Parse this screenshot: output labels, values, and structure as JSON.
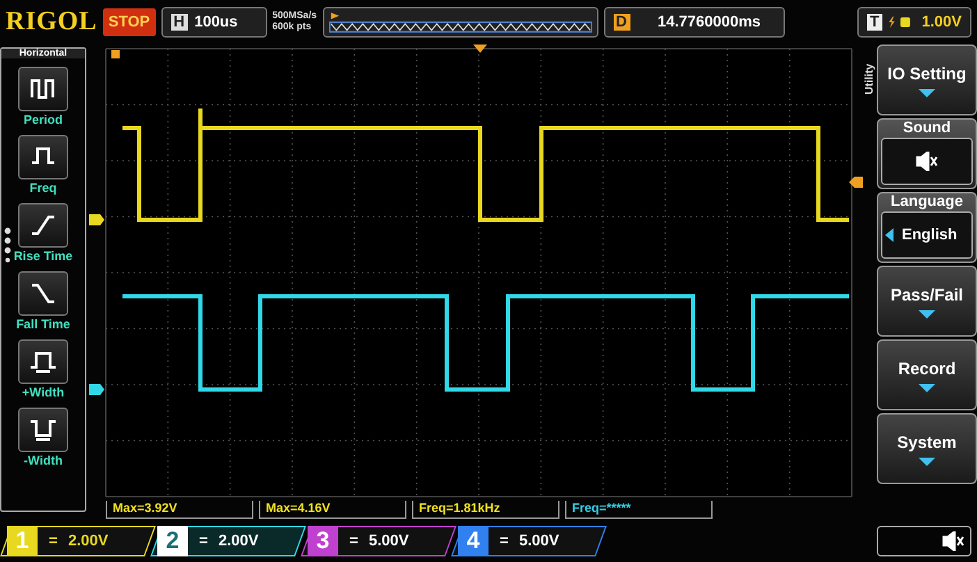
{
  "top_bar": {
    "logo": "RIGOL",
    "run_state": "STOP",
    "timebase_label": "H",
    "timebase": "100us",
    "sample_rate": "500MSa/s",
    "memory_depth": "600k pts",
    "delay_label": "D",
    "delay": "14.7760000ms",
    "trigger_label": "T",
    "trigger_level": "1.00V"
  },
  "measure_menu": {
    "title": "Horizontal",
    "items": [
      {
        "label": "Period",
        "kind": "period"
      },
      {
        "label": "Freq",
        "kind": "freq"
      },
      {
        "label": "Rise Time",
        "kind": "rise"
      },
      {
        "label": "Fall Time",
        "kind": "fall"
      },
      {
        "label": "+Width",
        "kind": "pwidth"
      },
      {
        "label": "-Width",
        "kind": "nwidth"
      }
    ]
  },
  "utility_menu": {
    "title": "Utility",
    "items": [
      {
        "kind": "button",
        "label": "IO Setting"
      },
      {
        "kind": "icon-field",
        "label": "Sound",
        "muted": true
      },
      {
        "kind": "select",
        "label": "Language",
        "value": "English"
      },
      {
        "kind": "button",
        "label": "Pass/Fail"
      },
      {
        "kind": "button",
        "label": "Record"
      },
      {
        "kind": "button",
        "label": "System"
      }
    ]
  },
  "measurements": [
    {
      "text": "Max=3.92V",
      "color": "#f0e020"
    },
    {
      "text": "Max=4.16V",
      "color": "#f0e020"
    },
    {
      "text": "Freq=1.81kHz",
      "color": "#f0e020"
    },
    {
      "text": "Freq=*****",
      "color": "#30d0e8"
    }
  ],
  "channels": [
    {
      "number": "1",
      "coupling": "=",
      "scale": "2.00V",
      "color": "#e8d820",
      "selected": false
    },
    {
      "number": "2",
      "coupling": "=",
      "scale": "2.00V",
      "color": "#30d8e8",
      "selected": true
    },
    {
      "number": "3",
      "coupling": "=",
      "scale": "5.00V",
      "color": "#c040d0",
      "selected": false
    },
    {
      "number": "4",
      "coupling": "=",
      "scale": "5.00V",
      "color": "#3080f0",
      "selected": false
    }
  ]
}
